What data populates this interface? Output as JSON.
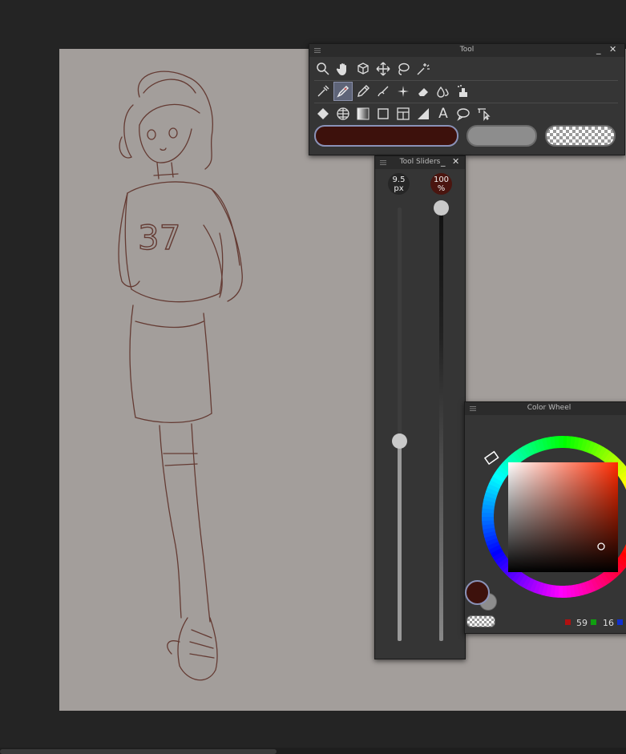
{
  "tool_panel": {
    "title": "Tool",
    "minimize": "_",
    "close": "✕",
    "rows": [
      [
        "zoom-icon",
        "hand-icon",
        "object-icon",
        "move-icon",
        "lasso-icon",
        "magic-wand-icon"
      ],
      [
        "eyedropper-icon",
        "pen-icon",
        "pencil-icon",
        "brush-icon",
        "airbrush-icon",
        "eraser-icon",
        "blend-icon",
        "figure-icon"
      ],
      [
        "fill-icon",
        "grid-icon",
        "gradient-icon",
        "rectangle-icon",
        "frame-icon",
        "ruler-icon",
        "text-icon",
        "balloon-icon",
        "operation-icon"
      ]
    ],
    "selected_tool": "pen-icon",
    "text_tool_glyph": "A",
    "main_color": "#3d110c",
    "sub_color": "#8d8d8d"
  },
  "tool_sliders": {
    "title": "Tool Sliders",
    "minimize": "_",
    "close": "✕",
    "size_value": "9.5",
    "size_unit": "px",
    "opacity_value": "100",
    "opacity_unit": "%",
    "size_level": 0.46,
    "opacity_level": 1.0
  },
  "color_wheel": {
    "title": "Color Wheel",
    "r": "59",
    "g": "16",
    "b": "",
    "current_color": "#3d110c"
  },
  "canvas": {
    "paper_color": "#a39e9b",
    "stroke_color": "#5a2a22",
    "sketch_number": "37"
  }
}
